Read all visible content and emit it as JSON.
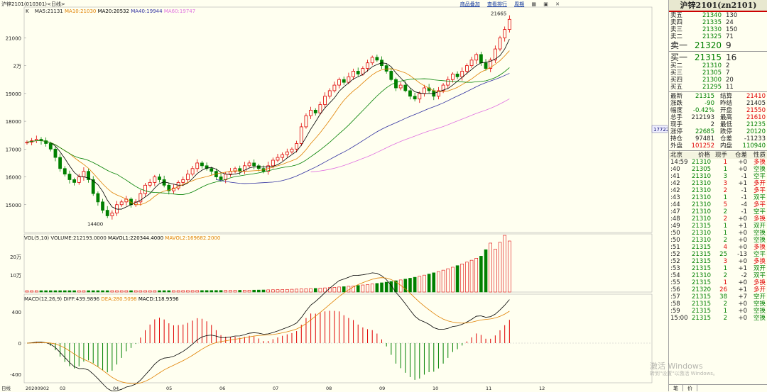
{
  "header": {
    "symbol_label": "沪锌2101(010301)<日线>",
    "ma_label": "K",
    "ma5": "MA5:21131",
    "ma10": "MA10:21030",
    "ma20": "MA20:20532",
    "ma40": "MA40:19944",
    "ma60": "MA60:19747",
    "links": [
      "商品叠加",
      "查看排行",
      "周期"
    ],
    "win_icons": [
      "▦",
      "▣",
      "✕"
    ]
  },
  "colors": {
    "up": "#e00000",
    "down": "#008000",
    "ma5": "#000000",
    "ma10": "#e08000",
    "ma20": "#008000",
    "ma40": "#3030a0",
    "ma60": "#e070e0"
  },
  "price_axis": [
    "21000",
    "2万",
    "19000",
    "18000",
    "17000",
    "16000",
    "15000"
  ],
  "price_marks": {
    "high": "21665",
    "low": "14400",
    "cross": "17722"
  },
  "vol": {
    "label": "VOL(5,10)",
    "volume": "VOLUME:212193.0000",
    "mavol1": "MAVOL1:220344.4000",
    "mavol2": "MAVOL2:169682.2000",
    "axis": [
      "20万",
      "10万"
    ]
  },
  "macd": {
    "label": "MACD(12,26,9)",
    "diff": "DIFF:439.9896",
    "dea": "DEA:280.5098",
    "macd": "MACD:118.9596",
    "axis": [
      "400",
      "0",
      "-400"
    ]
  },
  "dates": [
    "20200902",
    "03",
    "04",
    "05",
    "06",
    "07",
    "08",
    "09",
    "10",
    "11",
    "12"
  ],
  "date_axis_label": "日线",
  "chart_data": {
    "type": "candlestick",
    "title": "沪锌2101(010301)<日线>",
    "x_labels": [
      "03",
      "04",
      "05",
      "06",
      "07",
      "08",
      "09",
      "10",
      "11",
      "12"
    ],
    "ohlc_close_approx": [
      17250,
      17300,
      17350,
      17300,
      17200,
      17000,
      16700,
      16300,
      16100,
      15900,
      15800,
      16000,
      16200,
      15900,
      15400,
      15100,
      14800,
      14600,
      14700,
      15000,
      15100,
      15200,
      15000,
      15100,
      15400,
      15700,
      15800,
      16000,
      15900,
      15700,
      15500,
      15600,
      15800,
      15900,
      16100,
      16300,
      16500,
      16400,
      16300,
      16200,
      16000,
      15900,
      16100,
      16200,
      16300,
      16200,
      16400,
      16500,
      16400,
      16300,
      16200,
      16400,
      16600,
      16700,
      16800,
      16900,
      17000,
      17200,
      17800,
      18200,
      18400,
      18300,
      18600,
      18900,
      19100,
      19300,
      19500,
      19400,
      19600,
      19800,
      19700,
      19900,
      20100,
      20300,
      20200,
      20000,
      19800,
      19500,
      19200,
      19300,
      19100,
      18900,
      18800,
      19000,
      19200,
      19100,
      18900,
      19100,
      19300,
      19500,
      19700,
      19600,
      19800,
      20000,
      20200,
      20400,
      20100,
      19900,
      20200,
      20600,
      21000,
      21300,
      21665
    ],
    "ylim": [
      14000,
      21800
    ]
  },
  "panel": {
    "title": "沪锌2101(zn2101)",
    "asks": [
      [
        "卖五",
        "21340",
        "130"
      ],
      [
        "卖四",
        "21335",
        "24"
      ],
      [
        "卖三",
        "21330",
        "150"
      ],
      [
        "卖二",
        "21325",
        "71"
      ],
      [
        "卖一",
        "21320",
        "9"
      ]
    ],
    "bids": [
      [
        "买一",
        "21315",
        "16"
      ],
      [
        "买二",
        "21310",
        "2"
      ],
      [
        "买三",
        "21305",
        "7"
      ],
      [
        "买四",
        "21300",
        "20"
      ],
      [
        "买五",
        "21295",
        "11"
      ]
    ],
    "stats": [
      [
        "最新",
        "21315",
        "结算",
        "21410"
      ],
      [
        "涨跌",
        "-90",
        "昨结",
        "21405"
      ],
      [
        "幅度",
        "-0.42%",
        "开盘",
        "21550"
      ],
      [
        "总手",
        "212193",
        "最高",
        "21610"
      ],
      [
        "现手",
        "2",
        "最低",
        "21235"
      ],
      [
        "涨停",
        "22685",
        "跌停",
        "20120"
      ],
      [
        "持仓",
        "97481",
        "仓差",
        "-11233"
      ],
      [
        "外盘",
        "101252",
        "内盘",
        "110940"
      ]
    ],
    "tick_header": [
      "北京",
      "价格",
      "现手",
      "仓差",
      "性质"
    ],
    "ticks": [
      [
        "14:59",
        "21310",
        "1",
        "+0",
        "多换"
      ],
      [
        ":40",
        "21305",
        "1",
        "+0",
        "空换"
      ],
      [
        ":41",
        "21310",
        "3",
        "-1",
        "空平"
      ],
      [
        ":42",
        "21310",
        "3",
        "+1",
        "多开"
      ],
      [
        ":42",
        "21310",
        "2",
        "-1",
        "多平"
      ],
      [
        ":43",
        "21310",
        "1",
        "-1",
        "双平"
      ],
      [
        ":44",
        "21310",
        "5",
        "-4",
        "多平"
      ],
      [
        ":47",
        "21310",
        "2",
        "-1",
        "空平"
      ],
      [
        ":48",
        "21310",
        "2",
        "+0",
        "多换"
      ],
      [
        ":49",
        "21315",
        "1",
        "+1",
        "双开"
      ],
      [
        ":50",
        "21310",
        "1",
        "+0",
        "空换"
      ],
      [
        ":50",
        "21310",
        "2",
        "+0",
        "空换"
      ],
      [
        ":51",
        "21315",
        "4",
        "+0",
        "多换"
      ],
      [
        ":52",
        "21315",
        "25",
        "-13",
        "空平"
      ],
      [
        ":52",
        "21315",
        "3",
        "+0",
        "多换"
      ],
      [
        ":53",
        "21315",
        "1",
        "+1",
        "双开"
      ],
      [
        ":54",
        "21310",
        "2",
        "-2",
        "双平"
      ],
      [
        ":55",
        "21315",
        "1",
        "+0",
        "多换"
      ],
      [
        ":56",
        "21320",
        "26",
        "+1",
        "多开"
      ],
      [
        ":57",
        "21315",
        "38",
        "+7",
        "空开"
      ],
      [
        ":58",
        "21315",
        "2",
        "+0",
        "空换"
      ],
      [
        ":59",
        "21315",
        "1",
        "+0",
        "空换"
      ],
      [
        "15:00",
        "21315",
        "2",
        "+0",
        "空换"
      ]
    ],
    "tabs": [
      "笔",
      "价"
    ]
  },
  "watermark": {
    "line1": "激活 Windows",
    "line2": "转到\"设置\"以激活 Windows。"
  }
}
